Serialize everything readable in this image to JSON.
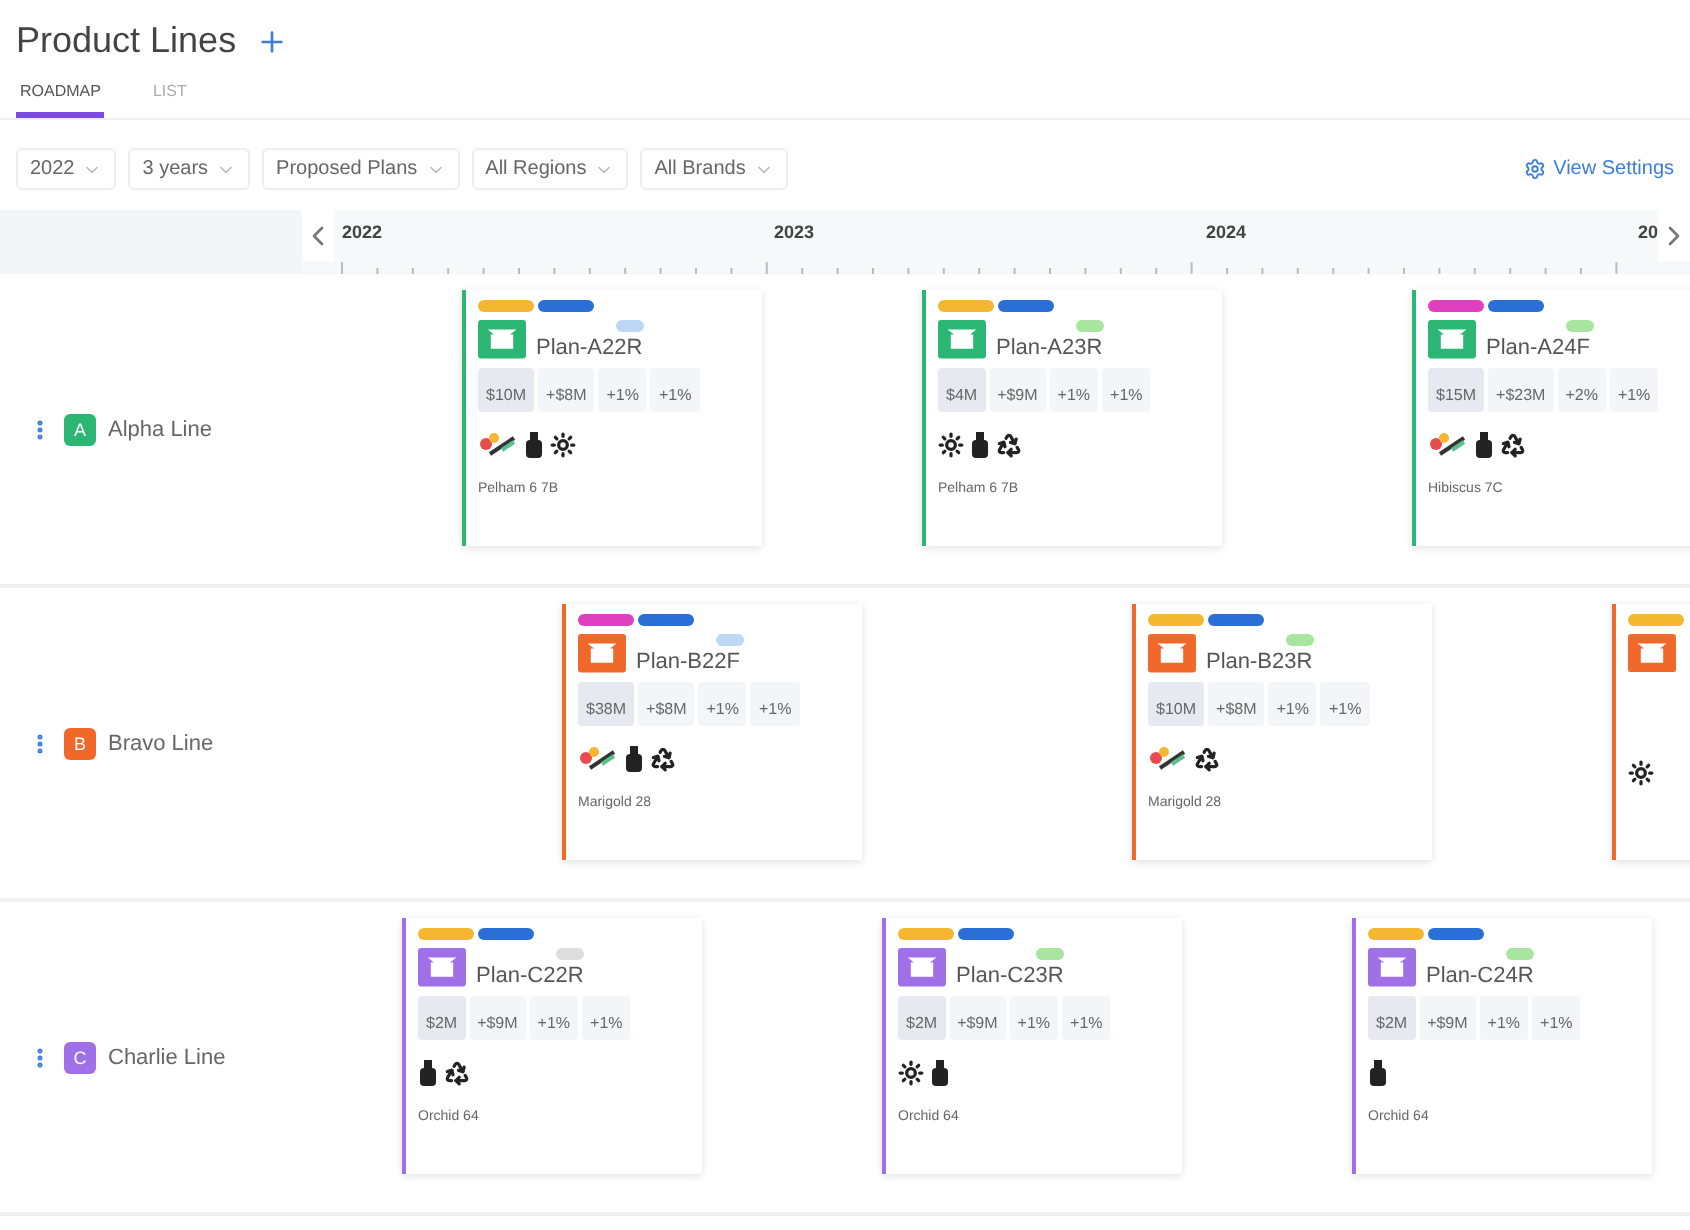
{
  "page": {
    "title": "Product Lines"
  },
  "tabs": [
    {
      "label": "ROADMAP",
      "selected": true
    },
    {
      "label": "LIST",
      "selected": false
    }
  ],
  "filters": [
    {
      "value": "2022"
    },
    {
      "value": "3 years"
    },
    {
      "value": "Proposed Plans"
    },
    {
      "value": "All Regions"
    },
    {
      "value": "All Brands"
    }
  ],
  "view_settings": "View Settings",
  "timeline": {
    "years": [
      "2022",
      "2023",
      "2024",
      "20"
    ]
  },
  "lines": [
    {
      "letter": "A",
      "name": "Alpha Line",
      "color": "#2bb673",
      "cards": [
        {
          "kind": "full",
          "tags": [
            {
              "color": "#f5b731"
            },
            {
              "color": "#2a6fd6"
            }
          ],
          "status": {
            "color": "#bcd8f5"
          },
          "title": "Plan-A22R",
          "metrics": [
            "$10M",
            "+$8M",
            "+1%",
            "+1%"
          ],
          "icons": [
            {
              "kind": "palette"
            },
            {
              "kind": "bottle"
            },
            {
              "kind": "sun"
            }
          ],
          "site": "Pelham 6 7B"
        },
        {
          "kind": "full",
          "tags": [
            {
              "color": "#f5b731"
            },
            {
              "color": "#2a6fd6"
            }
          ],
          "status": {
            "color": "#a8e6a0"
          },
          "title": "Plan-A23R",
          "metrics": [
            "$4M",
            "+$9M",
            "+1%",
            "+1%"
          ],
          "icons": [
            {
              "kind": "sun"
            },
            {
              "kind": "bottle"
            },
            {
              "kind": "recycle"
            }
          ],
          "site": "Pelham 6 7B"
        },
        {
          "kind": "full",
          "tags": [
            {
              "color": "#e040c0"
            },
            {
              "color": "#2a6fd6"
            }
          ],
          "status": {
            "color": "#a8e6a0"
          },
          "title": "Plan-A24F",
          "metrics": [
            "$15M",
            "+$23M",
            "+2%",
            "+1%"
          ],
          "icons": [
            {
              "kind": "palette"
            },
            {
              "kind": "bottle"
            },
            {
              "kind": "recycle"
            }
          ],
          "site": "Hibiscus 7C"
        }
      ]
    },
    {
      "letter": "B",
      "name": "Bravo Line",
      "color": "#f0692a",
      "cards": [
        {
          "kind": "full",
          "tags": [
            {
              "color": "#e040c0"
            },
            {
              "color": "#2a6fd6"
            }
          ],
          "status": {
            "color": "#bcd8f5"
          },
          "title": "Plan-B22F",
          "metrics": [
            "$38M",
            "+$8M",
            "+1%",
            "+1%"
          ],
          "icons": [
            {
              "kind": "palette"
            },
            {
              "kind": "bottle"
            },
            {
              "kind": "recycle"
            }
          ],
          "site": "Marigold 28"
        },
        {
          "kind": "full",
          "tags": [
            {
              "color": "#f5b731"
            },
            {
              "color": "#2a6fd6"
            }
          ],
          "status": {
            "color": "#a8e6a0"
          },
          "title": "Plan-B23R",
          "metrics": [
            "$10M",
            "+$8M",
            "+1%",
            "+1%"
          ],
          "icons": [
            {
              "kind": "palette"
            },
            {
              "kind": "recycle"
            }
          ],
          "site": "Marigold 28"
        },
        {
          "kind": "partial",
          "tags": [
            {
              "color": "#f5b731"
            }
          ],
          "icons": [
            {
              "kind": "sun"
            }
          ]
        }
      ]
    },
    {
      "letter": "C",
      "name": "Charlie Line",
      "color": "#a070e6",
      "cards": [
        {
          "kind": "full",
          "tags": [
            {
              "color": "#f5b731"
            },
            {
              "color": "#2a6fd6"
            }
          ],
          "status": {
            "color": "#dddddd"
          },
          "title": "Plan-C22R",
          "metrics": [
            "$2M",
            "+$9M",
            "+1%",
            "+1%"
          ],
          "icons": [
            {
              "kind": "bottle"
            },
            {
              "kind": "recycle"
            }
          ],
          "site": "Orchid 64"
        },
        {
          "kind": "full",
          "tags": [
            {
              "color": "#f5b731"
            },
            {
              "color": "#2a6fd6"
            }
          ],
          "status": {
            "color": "#a8e6a0"
          },
          "title": "Plan-C23R",
          "metrics": [
            "$2M",
            "+$9M",
            "+1%",
            "+1%"
          ],
          "icons": [
            {
              "kind": "sun"
            },
            {
              "kind": "bottle"
            }
          ],
          "site": "Orchid 64"
        },
        {
          "kind": "full",
          "tags": [
            {
              "color": "#f5b731"
            },
            {
              "color": "#2a6fd6"
            }
          ],
          "status": {
            "color": "#a8e6a0"
          },
          "title": "Plan-C24R",
          "metrics": [
            "$2M",
            "+$9M",
            "+1%",
            "+1%"
          ],
          "icons": [
            {
              "kind": "bottle"
            }
          ],
          "site": "Orchid 64"
        }
      ]
    }
  ]
}
